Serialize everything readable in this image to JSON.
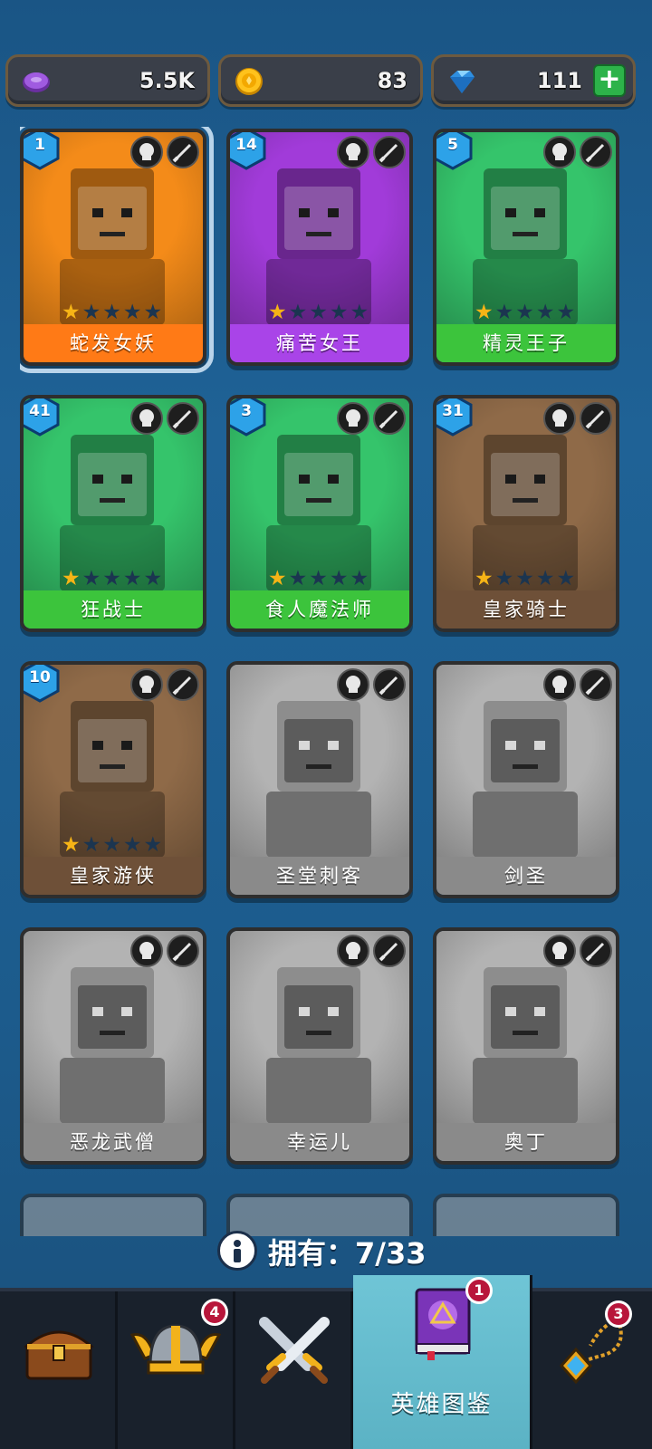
{
  "currencies": [
    {
      "icon": "purple-gem-icon",
      "value": "5.5K"
    },
    {
      "icon": "gold-coin-icon",
      "value": "83"
    },
    {
      "icon": "blue-diamond-icon",
      "value": "111"
    }
  ],
  "heroes": [
    {
      "name": "蛇发女妖",
      "level": "1",
      "stars": 1,
      "bar_color": "#ff7a16",
      "bg": "#f48b19",
      "selected": true
    },
    {
      "name": "痛苦女王",
      "level": "14",
      "stars": 1,
      "bar_color": "#a944e8",
      "bg": "#a13bd9"
    },
    {
      "name": "精灵王子",
      "level": "5",
      "stars": 1,
      "bar_color": "#3cc43c",
      "bg": "#35c46b"
    },
    {
      "name": "狂战士",
      "level": "41",
      "stars": 1,
      "bar_color": "#3cc43c",
      "bg": "#35c46b"
    },
    {
      "name": "食人魔法师",
      "level": "3",
      "stars": 1,
      "bar_color": "#3cc43c",
      "bg": "#35c46b"
    },
    {
      "name": "皇家骑士",
      "level": "31",
      "stars": 1,
      "bar_color": "#6e5038",
      "bg": "#8f6a48"
    },
    {
      "name": "皇家游侠",
      "level": "10",
      "stars": 1,
      "bar_color": "#6e5038",
      "bg": "#8f6a48"
    },
    {
      "name": "圣堂刺客",
      "level": "",
      "stars": 0,
      "bar_color": "#8a8a8a",
      "bg": "#b3b3b3"
    },
    {
      "name": "剑圣",
      "level": "",
      "stars": 0,
      "bar_color": "#8a8a8a",
      "bg": "#b3b3b3"
    },
    {
      "name": "恶龙武僧",
      "level": "",
      "stars": 0,
      "bar_color": "#8a8a8a",
      "bg": "#b3b3b3"
    },
    {
      "name": "幸运儿",
      "level": "",
      "stars": 0,
      "bar_color": "#8a8a8a",
      "bg": "#b3b3b3"
    },
    {
      "name": "奥丁",
      "level": "",
      "stars": 0,
      "bar_color": "#8a8a8a",
      "bg": "#b3b3b3"
    }
  ],
  "owned": {
    "label": "拥有：",
    "value": "7/33"
  },
  "nav": [
    {
      "icon": "treasure-chest-icon",
      "badge": "",
      "label": ""
    },
    {
      "icon": "viking-helmet-icon",
      "badge": "4",
      "label": ""
    },
    {
      "icon": "crossed-swords-icon",
      "badge": "",
      "label": ""
    },
    {
      "icon": "hero-book-icon",
      "badge": "1",
      "label": "英雄图鉴"
    },
    {
      "icon": "amulet-icon",
      "badge": "3",
      "label": ""
    }
  ]
}
